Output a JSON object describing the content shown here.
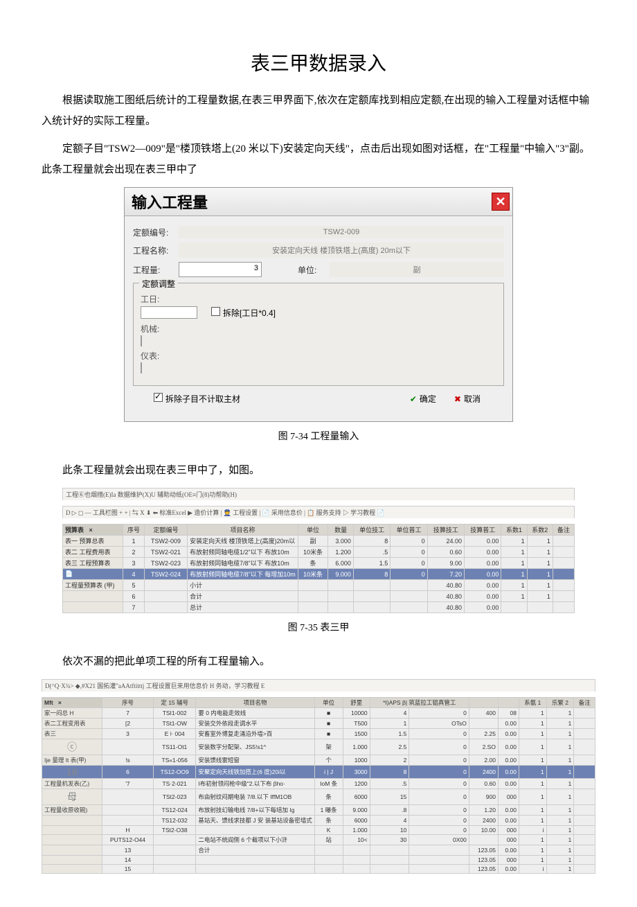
{
  "title": "表三甲数据录入",
  "para1": "根据读取施工图纸后统计的工程量数据,在表三甲界面下,依次在定额库找到相应定额,在出现的输入工程量对话框中输入统计好的实际工程量。",
  "para2": "定额子目\"TSW2—009\"是\"楼顶铁塔上(20 米以下)安装定向天线\"，点击后出现如图对话框，在\"工程量\"中输入\"3\"副。此条工程量就会出现在表三甲中了",
  "caption1": "图 7-34 工程量输入",
  "para3": "此条工程量就会出现在表三甲中了，如图。",
  "caption2": "图 7-35 表三甲",
  "para4": "依次不漏的把此单项工程的所有工程量输入。",
  "dialog": {
    "title": "输入工程量",
    "code_label": "定额编号:",
    "code_value": "TSW2-009",
    "name_label": "工程名称:",
    "name_value": "安装定向天线 楼顶铁塔上(高度) 20m以下",
    "qty_label": "工程量:",
    "qty_value": "3",
    "unit_label": "单位:",
    "unit_value": "副",
    "adjust_legend": "定额调整",
    "gr_label": "工日:",
    "dismantle_cb": "拆除[工日*0.4]",
    "jx_label": "机械:",
    "yb_label": "仪表:",
    "exclude_main": "拆除子目不计取主材",
    "ok": "确定",
    "cancel": "取消"
  },
  "fig1": {
    "toolbar": "工程⑥也烟措(E)Ia 数据维护(X)U 辅助动纸(OE≡门(8)功帮助(H)",
    "toolbar2": "D ▷ ◻ — 工具栏图 + + | ⇆ X ⬇ ⬅ 标准Excel ▶ 造价计算 | 👮 工程设置 | 📄 采用信息价 | 📋 服务支持 ▷ 学习教程 📄",
    "side_header": "预算表",
    "side": [
      "表一 预算总表",
      "表二 工程费用表",
      "表三 工程预算表",
      "",
      "工程量预算表 (甲)"
    ],
    "headers": [
      "序号",
      "定额编号",
      "项目名称",
      "单位",
      "数量",
      "单位技工",
      "单位普工",
      "技算技工",
      "技算普工",
      "系数1",
      "系数2",
      "备注"
    ],
    "rows": [
      [
        "1",
        "TSW2-009",
        "安装定向天线 楼顶铁塔上(高度)20m以",
        "副",
        "3.000",
        "8",
        "0",
        "24.00",
        "0.00",
        "1",
        "1",
        ""
      ],
      [
        "2",
        "TSW2-021",
        "布放射频同轴电缆1/2\"以下 布放10m",
        "10米条",
        "1.200",
        ".5",
        "0",
        "0.60",
        "0.00",
        "1",
        "1",
        ""
      ],
      [
        "3",
        "TSW2-023",
        "布放射频同轴电缆7/8\"以下 布放10m",
        "条",
        "6.000",
        "1.5",
        "0",
        "9.00",
        "0.00",
        "1",
        "1",
        ""
      ],
      [
        "4",
        "TSW2-024",
        "布放射频同轴电缆7/8\"以下 每增加10m",
        "10米条",
        "9.000",
        "8",
        "0",
        "7.20",
        "0.00",
        "1",
        "1",
        ""
      ],
      [
        "5",
        "",
        "小计",
        "",
        "",
        "",
        "",
        "40.80",
        "0.00",
        "1",
        "1",
        ""
      ],
      [
        "6",
        "",
        "合计",
        "",
        "",
        "",
        "",
        "40.80",
        "0.00",
        "1",
        "1",
        ""
      ],
      [
        "7",
        "",
        "总计",
        "",
        "",
        "",
        "",
        "40.80",
        "0.00",
        "",
        "",
        ""
      ]
    ]
  },
  "fig2": {
    "topline": "D(^Q·X¾>            ◆,#X21 国拓灌\"aAAtftitttj           工程设置巨来用信息价           H 务动，学习教程 E",
    "mft": "Mft",
    "side": [
      "家一闷总 H",
      "表二工程变用表",
      "表三",
      "ⓒ",
      "Ije 量理 It 表(甲)",
      "18",
      "工程量机发表(乙)",
      "母",
      "工程量收原收碗)"
    ],
    "headers": [
      "序号",
      "定 15 辅号",
      "项目名物",
      "单位",
      "舒里",
      "*I)APS β| 筑蓝拉工铝真管工",
      "",
      "",
      "",
      "系氨 1",
      "乐繁 2",
      "备注"
    ],
    "rows": [
      [
        "7",
        "TSI1-002",
        "要 0 内电能走效线",
        "■",
        "10000",
        "4",
        "0",
        "400",
        "08",
        "1",
        "1",
        ""
      ],
      [
        "[2",
        "TSt1-OW",
        "安装交外依段走调水平",
        "■",
        "T500",
        "1",
        "OTsO",
        "",
        "0.00",
        "1",
        "1",
        ""
      ],
      [
        "3",
        "E ⊦ 004",
        "安畜室外博复走涌沿外墙>百",
        "■",
        "1500",
        "1.5",
        "0",
        "2.25",
        "0.00",
        "1",
        "1",
        ""
      ],
      [
        "",
        "TS11-Ot1",
        "安装数字分配架、JS5!s1^",
        "架",
        "1.000",
        "2.5",
        "0",
        "2.SO",
        "0.00",
        "1",
        "1",
        ""
      ],
      [
        "!s",
        "TS«1-056",
        "安装馈线雷短窗",
        "个",
        "1000",
        "2",
        "0",
        "2.00",
        "0.00",
        "1",
        "1",
        ""
      ],
      [
        "6",
        "TS12-OO9",
        "安聚定向天线铁加搭上(6 度)20i以",
        "i | J",
        "3000",
        "8",
        "0",
        "2400",
        "0.00",
        "1",
        "1",
        ""
      ],
      [
        "'7",
        "TS·2-021",
        "I布初射领闷枪中级\"2.以下布 βho·",
        "IoM 条",
        "1200",
        ".5",
        "0",
        "0.60",
        "0.00",
        "1",
        "1",
        ""
      ],
      [
        "",
        "TSt2-023",
        "布由射纹闷期电装 7/8.以下 IffM1OB",
        "条",
        "6000",
        "15",
        "0",
        "900",
        "000",
        "1",
        "1",
        ""
      ],
      [
        "",
        "TS12-024",
        "布放射技幻输电线 7/8+以下每培加 Ig",
        "1 曝条",
        "9.000",
        ".8",
        "0",
        "1.20",
        "0.00",
        "1",
        "1",
        ""
      ],
      [
        "",
        "TS12-032",
        "基站天、馈线求技都 J 安 装基站设备密墙式",
        "条",
        "6000",
        "4",
        "0",
        "2400",
        "0.00",
        "1",
        "1",
        ""
      ],
      [
        "H",
        "TSt2-O38",
        "",
        "K",
        "1.000",
        "10",
        "0",
        "10.00",
        "000",
        "i",
        "1",
        ""
      ],
      [
        "PUTS12-O44",
        "",
        "二电站不统阎侧 6 个截项以下小浒",
        "站",
        "10<",
        "30",
        "0X00",
        "",
        "000",
        "1",
        "1",
        ""
      ],
      [
        "13",
        "",
        "合计",
        "",
        "",
        "",
        "",
        "123.05",
        "0.00",
        "1",
        "1",
        ""
      ],
      [
        "14",
        "",
        "",
        "",
        "",
        "",
        "",
        "123.05",
        "000",
        "1",
        "1",
        ""
      ],
      [
        "15",
        "",
        "",
        "",
        "",
        "",
        "",
        "123.05",
        "0.00",
        "i",
        "1",
        ""
      ]
    ]
  }
}
